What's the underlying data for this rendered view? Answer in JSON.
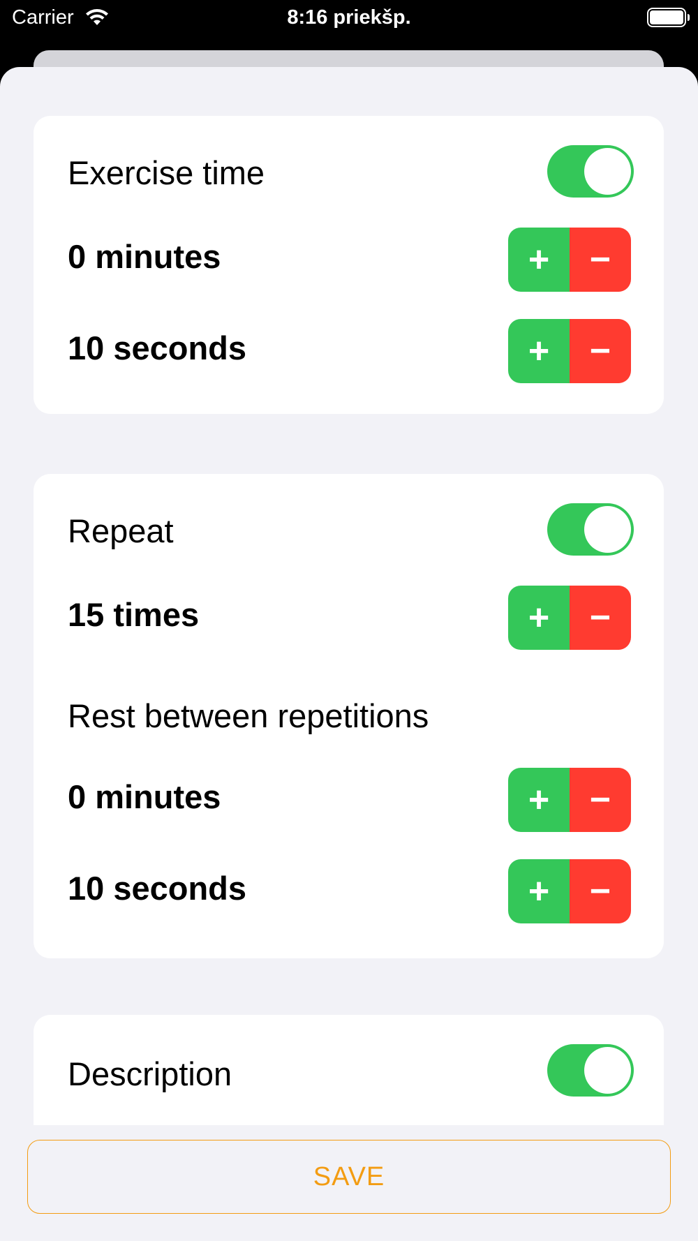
{
  "status_bar": {
    "carrier": "Carrier",
    "time": "8:16 priekšp."
  },
  "colors": {
    "toggle_on": "#34c759",
    "increment": "#34c759",
    "decrement": "#ff3b30",
    "accent": "#f39c12",
    "background": "#f2f2f7"
  },
  "exercise": {
    "label": "Exercise time",
    "enabled": true,
    "minutes": "0 minutes",
    "seconds": "10 seconds"
  },
  "repeat": {
    "label": "Repeat",
    "enabled": true,
    "times": "15 times",
    "rest_label": "Rest between repetitions",
    "rest_minutes": "0 minutes",
    "rest_seconds": "10 seconds"
  },
  "description": {
    "label": "Description",
    "enabled": true
  },
  "stepper": {
    "plus": "+",
    "minus": "−"
  },
  "save_label": "SAVE"
}
